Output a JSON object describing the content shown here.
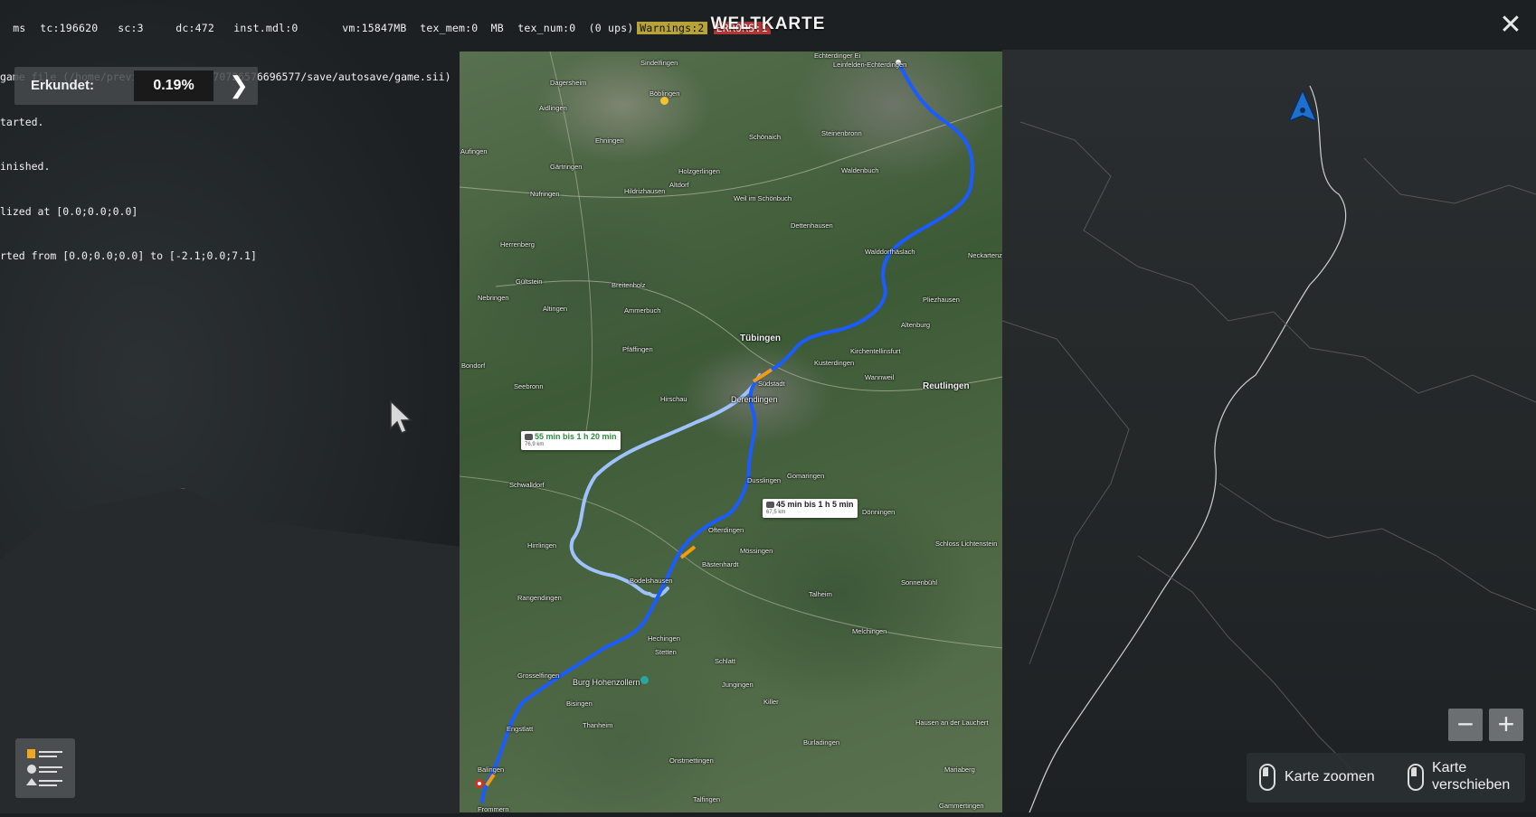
{
  "debug": {
    "items": [
      "ms",
      "tc:196620",
      "sc:3",
      "dc:472",
      "inst.mdl:0",
      "vm:15847MB",
      "tex_mem:0  MB",
      "tex_num:0  (0 ups)"
    ],
    "warnings": "Warnings:2",
    "errors": "ERRORS:1",
    "lines": [
      "game file (/home/preview_profiles/70726576696577/save/autosave/game.sii) ...",
      "tarted.",
      "inished.",
      "lized at [0.0;0.0;0.0]",
      "rted from [0.0;0.0;0.0] to [-2.1;0.0;7.1]"
    ]
  },
  "title": "WELTKARTE",
  "close_icon": "close-icon",
  "explored": {
    "label": "Erkundet:",
    "value": "0.19%",
    "arrow_icon": "chevron-right-icon"
  },
  "map": {
    "places_big": [
      "Tübingen",
      "Reutlingen"
    ],
    "places": [
      "Echterdinger Ei",
      "Leinfelden-Echterdingen",
      "Aidlingen",
      "Ehningen",
      "Schönaich",
      "Steinenbronn",
      "Gärtringen",
      "Holzgerlingen",
      "Waldenbuch",
      "Nufringen",
      "Hildrizhausen",
      "Altdorf",
      "Weil im Schönbuch",
      "Dettenhausen",
      "Walddorfhäslach",
      "Neckartenzlingen",
      "Herrenberg",
      "Gültstein",
      "Altingen",
      "Breitenholz",
      "Ammerbuch",
      "Pliezhausen",
      "Nebringen",
      "Altenburg",
      "Pfäffingen",
      "Kirchentellinsfurt",
      "Kusterdingen",
      "Wannweil",
      "Bondorf",
      "Seebronn",
      "Hirschau",
      "Derendingen",
      "Südstadt",
      "Schwalldorf",
      "Gomaringen",
      "Dusslingen",
      "Dönningen",
      "Hirrlingen",
      "Ofterdingen",
      "Mössingen",
      "Bästenhardt",
      "Schloss Lichtenstein",
      "Sonnenbühl",
      "Bodelshausen",
      "Rangendingen",
      "Talheim",
      "Hechingen",
      "Stetten",
      "Melchingen",
      "Grosselfingen",
      "Burg Hohenzollern",
      "Schlatt",
      "Jungingen",
      "Bisingen",
      "Killer",
      "Thanheim",
      "Engstlatt",
      "Burladingen",
      "Onstmettingen",
      "Balingen",
      "Mariaberg",
      "Talfingen",
      "Frommern",
      "Gammertingen",
      "Hausen an der Lauchert",
      "Aufingen",
      "Dagersheim",
      "Böblingen",
      "Sindelfingen"
    ],
    "route_main": {
      "time": "45 min bis 1 h 5 min",
      "dist": "67,5 km"
    },
    "route_alt": {
      "time": "55 min bis 1 h 20 min",
      "dist": "76,9 km"
    },
    "route_color": "#1a5cff",
    "alt_route_color": "#9fc2ff"
  },
  "player_marker": "player-truck-marker-icon",
  "legend_icon": "map-legend-icon",
  "zoom": {
    "minus": "−",
    "plus": "+"
  },
  "hints": {
    "zoom": "Karte zoomen",
    "move_line1": "Karte",
    "move_line2": "verschieben"
  }
}
